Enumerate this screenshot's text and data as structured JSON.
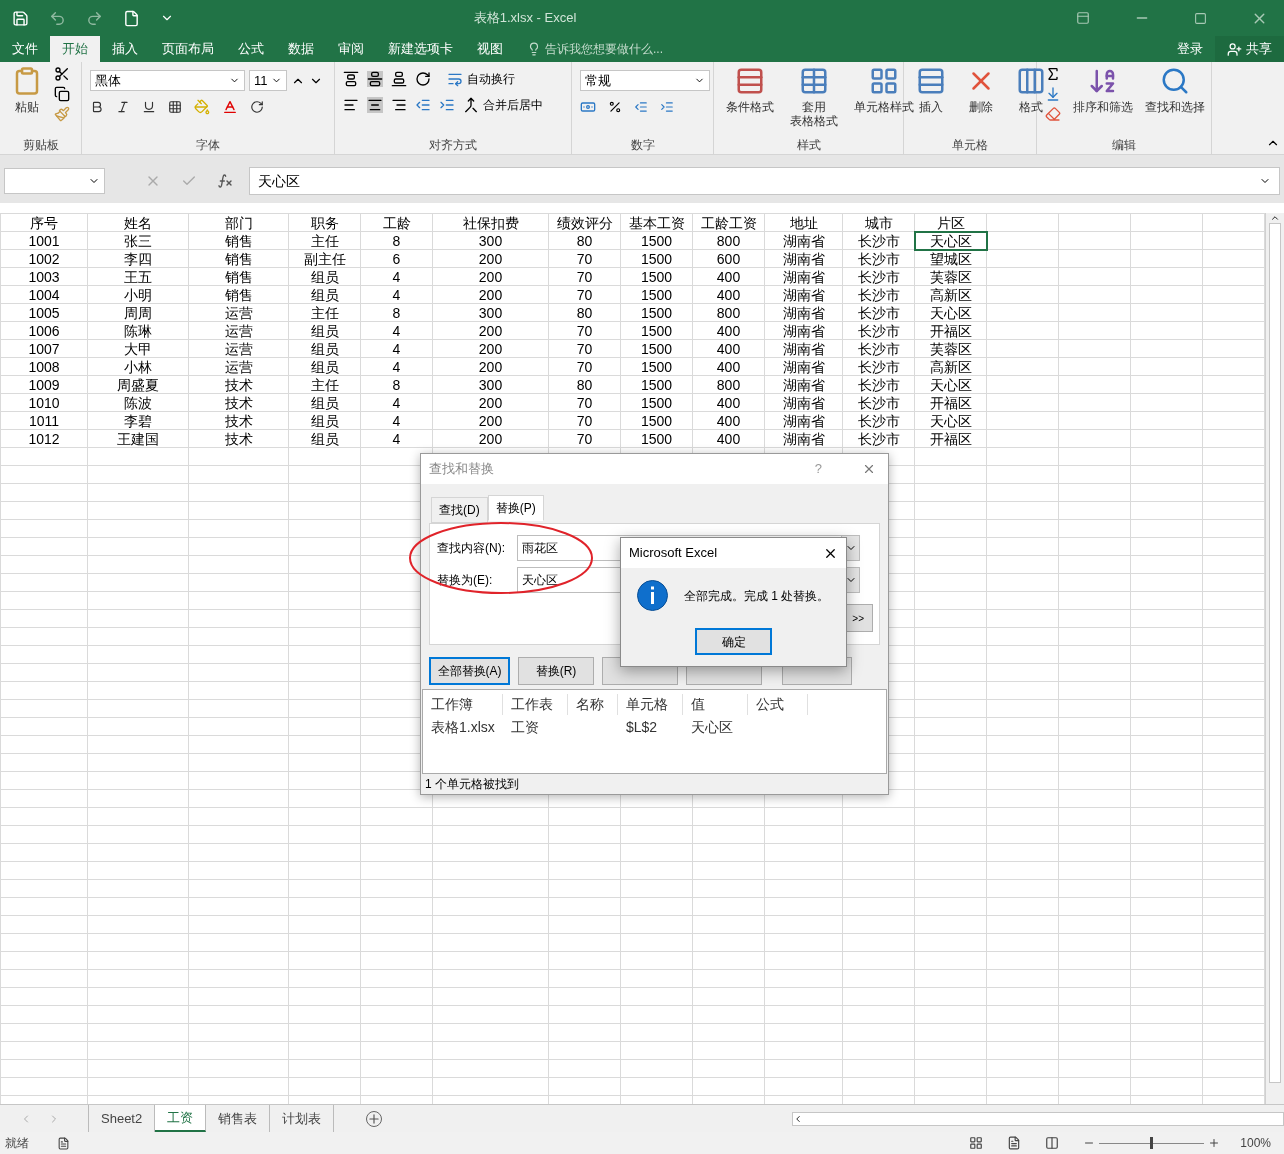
{
  "window": {
    "title": "表格1.xlsx - Excel"
  },
  "ribbon_tabs": [
    {
      "label": "文件",
      "selected": false
    },
    {
      "label": "开始",
      "selected": true
    },
    {
      "label": "插入",
      "selected": false
    },
    {
      "label": "页面布局",
      "selected": false
    },
    {
      "label": "公式",
      "selected": false
    },
    {
      "label": "数据",
      "selected": false
    },
    {
      "label": "审阅",
      "selected": false
    },
    {
      "label": "新建选项卡",
      "selected": false
    },
    {
      "label": "视图",
      "selected": false
    }
  ],
  "tell_me": "告诉我您想要做什么...",
  "account": {
    "sign_in": "登录",
    "share": "共享"
  },
  "ribbon": {
    "clipboard": {
      "label": "剪贴板",
      "paste": "粘贴"
    },
    "font": {
      "label": "字体",
      "font_name": "黑体",
      "font_size": "11"
    },
    "alignment": {
      "label": "对齐方式",
      "wrap": "自动换行",
      "merge": "合并后居中"
    },
    "number": {
      "label": "数字",
      "format": "常规"
    },
    "styles": {
      "label": "样式",
      "buttons": [
        {
          "kind": "conditional",
          "label": "条件格式"
        },
        {
          "kind": "table",
          "label": "套用",
          "label2": "表格格式"
        },
        {
          "kind": "cellstyle",
          "label": "单元格样式"
        }
      ]
    },
    "cells": {
      "label": "单元格",
      "buttons": [
        {
          "kind": "insert",
          "label": "插入"
        },
        {
          "kind": "delete",
          "label": "删除"
        },
        {
          "kind": "format",
          "label": "格式"
        }
      ]
    },
    "editing": {
      "label": "编辑",
      "buttons": [
        {
          "kind": "sort",
          "label": "排序和筛选"
        },
        {
          "kind": "find",
          "label": "查找和选择"
        }
      ]
    }
  },
  "formula_bar": {
    "value": "天心区"
  },
  "sheet": {
    "columns": [
      "序号",
      "姓名",
      "部门",
      "职务",
      "工龄",
      "社保扣费",
      "绩效评分",
      "基本工资",
      "工龄工资",
      "地址",
      "城市",
      "片区"
    ],
    "rows": [
      {
        "cells": [
          {
            "text": "1001",
            "selected": false
          },
          {
            "text": "张三",
            "selected": false
          },
          {
            "text": "销售",
            "selected": false
          },
          {
            "text": "主任",
            "selected": false
          },
          {
            "text": "8",
            "selected": false
          },
          {
            "text": "300",
            "selected": false
          },
          {
            "text": "80",
            "selected": false
          },
          {
            "text": "1500",
            "selected": false
          },
          {
            "text": "800",
            "selected": false
          },
          {
            "text": "湖南省",
            "selected": false
          },
          {
            "text": "长沙市",
            "selected": false
          },
          {
            "text": "天心区",
            "selected": true
          }
        ]
      },
      {
        "cells": [
          {
            "text": "1002",
            "selected": false
          },
          {
            "text": "李四",
            "selected": false
          },
          {
            "text": "销售",
            "selected": false
          },
          {
            "text": "副主任",
            "selected": false
          },
          {
            "text": "6",
            "selected": false
          },
          {
            "text": "200",
            "selected": false
          },
          {
            "text": "70",
            "selected": false
          },
          {
            "text": "1500",
            "selected": false
          },
          {
            "text": "600",
            "selected": false
          },
          {
            "text": "湖南省",
            "selected": false
          },
          {
            "text": "长沙市",
            "selected": false
          },
          {
            "text": "望城区",
            "selected": false
          }
        ]
      },
      {
        "cells": [
          {
            "text": "1003",
            "selected": false
          },
          {
            "text": "王五",
            "selected": false
          },
          {
            "text": "销售",
            "selected": false
          },
          {
            "text": "组员",
            "selected": false
          },
          {
            "text": "4",
            "selected": false
          },
          {
            "text": "200",
            "selected": false
          },
          {
            "text": "70",
            "selected": false
          },
          {
            "text": "1500",
            "selected": false
          },
          {
            "text": "400",
            "selected": false
          },
          {
            "text": "湖南省",
            "selected": false
          },
          {
            "text": "长沙市",
            "selected": false
          },
          {
            "text": "芙蓉区",
            "selected": false
          }
        ]
      },
      {
        "cells": [
          {
            "text": "1004",
            "selected": false
          },
          {
            "text": "小明",
            "selected": false
          },
          {
            "text": "销售",
            "selected": false
          },
          {
            "text": "组员",
            "selected": false
          },
          {
            "text": "4",
            "selected": false
          },
          {
            "text": "200",
            "selected": false
          },
          {
            "text": "70",
            "selected": false
          },
          {
            "text": "1500",
            "selected": false
          },
          {
            "text": "400",
            "selected": false
          },
          {
            "text": "湖南省",
            "selected": false
          },
          {
            "text": "长沙市",
            "selected": false
          },
          {
            "text": "高新区",
            "selected": false
          }
        ]
      },
      {
        "cells": [
          {
            "text": "1005",
            "selected": false
          },
          {
            "text": "周周",
            "selected": false
          },
          {
            "text": "运营",
            "selected": false
          },
          {
            "text": "主任",
            "selected": false
          },
          {
            "text": "8",
            "selected": false
          },
          {
            "text": "300",
            "selected": false
          },
          {
            "text": "80",
            "selected": false
          },
          {
            "text": "1500",
            "selected": false
          },
          {
            "text": "800",
            "selected": false
          },
          {
            "text": "湖南省",
            "selected": false
          },
          {
            "text": "长沙市",
            "selected": false
          },
          {
            "text": "天心区",
            "selected": false
          }
        ]
      },
      {
        "cells": [
          {
            "text": "1006",
            "selected": false
          },
          {
            "text": "陈琳",
            "selected": false
          },
          {
            "text": "运营",
            "selected": false
          },
          {
            "text": "组员",
            "selected": false
          },
          {
            "text": "4",
            "selected": false
          },
          {
            "text": "200",
            "selected": false
          },
          {
            "text": "70",
            "selected": false
          },
          {
            "text": "1500",
            "selected": false
          },
          {
            "text": "400",
            "selected": false
          },
          {
            "text": "湖南省",
            "selected": false
          },
          {
            "text": "长沙市",
            "selected": false
          },
          {
            "text": "开福区",
            "selected": false
          }
        ]
      },
      {
        "cells": [
          {
            "text": "1007",
            "selected": false
          },
          {
            "text": "大甲",
            "selected": false
          },
          {
            "text": "运营",
            "selected": false
          },
          {
            "text": "组员",
            "selected": false
          },
          {
            "text": "4",
            "selected": false
          },
          {
            "text": "200",
            "selected": false
          },
          {
            "text": "70",
            "selected": false
          },
          {
            "text": "1500",
            "selected": false
          },
          {
            "text": "400",
            "selected": false
          },
          {
            "text": "湖南省",
            "selected": false
          },
          {
            "text": "长沙市",
            "selected": false
          },
          {
            "text": "芙蓉区",
            "selected": false
          }
        ]
      },
      {
        "cells": [
          {
            "text": "1008",
            "selected": false
          },
          {
            "text": "小林",
            "selected": false
          },
          {
            "text": "运营",
            "selected": false
          },
          {
            "text": "组员",
            "selected": false
          },
          {
            "text": "4",
            "selected": false
          },
          {
            "text": "200",
            "selected": false
          },
          {
            "text": "70",
            "selected": false
          },
          {
            "text": "1500",
            "selected": false
          },
          {
            "text": "400",
            "selected": false
          },
          {
            "text": "湖南省",
            "selected": false
          },
          {
            "text": "长沙市",
            "selected": false
          },
          {
            "text": "高新区",
            "selected": false
          }
        ]
      },
      {
        "cells": [
          {
            "text": "1009",
            "selected": false
          },
          {
            "text": "周盛夏",
            "selected": false
          },
          {
            "text": "技术",
            "selected": false
          },
          {
            "text": "主任",
            "selected": false
          },
          {
            "text": "8",
            "selected": false
          },
          {
            "text": "300",
            "selected": false
          },
          {
            "text": "80",
            "selected": false
          },
          {
            "text": "1500",
            "selected": false
          },
          {
            "text": "800",
            "selected": false
          },
          {
            "text": "湖南省",
            "selected": false
          },
          {
            "text": "长沙市",
            "selected": false
          },
          {
            "text": "天心区",
            "selected": false
          }
        ]
      },
      {
        "cells": [
          {
            "text": "1010",
            "selected": false
          },
          {
            "text": "陈波",
            "selected": false
          },
          {
            "text": "技术",
            "selected": false
          },
          {
            "text": "组员",
            "selected": false
          },
          {
            "text": "4",
            "selected": false
          },
          {
            "text": "200",
            "selected": false
          },
          {
            "text": "70",
            "selected": false
          },
          {
            "text": "1500",
            "selected": false
          },
          {
            "text": "400",
            "selected": false
          },
          {
            "text": "湖南省",
            "selected": false
          },
          {
            "text": "长沙市",
            "selected": false
          },
          {
            "text": "开福区",
            "selected": false
          }
        ]
      },
      {
        "cells": [
          {
            "text": "1011",
            "selected": false
          },
          {
            "text": "李碧",
            "selected": false
          },
          {
            "text": "技术",
            "selected": false
          },
          {
            "text": "组员",
            "selected": false
          },
          {
            "text": "4",
            "selected": false
          },
          {
            "text": "200",
            "selected": false
          },
          {
            "text": "70",
            "selected": false
          },
          {
            "text": "1500",
            "selected": false
          },
          {
            "text": "400",
            "selected": false
          },
          {
            "text": "湖南省",
            "selected": false
          },
          {
            "text": "长沙市",
            "selected": false
          },
          {
            "text": "天心区",
            "selected": false
          }
        ]
      },
      {
        "cells": [
          {
            "text": "1012",
            "selected": false
          },
          {
            "text": "王建国",
            "selected": false
          },
          {
            "text": "技术",
            "selected": false
          },
          {
            "text": "组员",
            "selected": false
          },
          {
            "text": "4",
            "selected": false
          },
          {
            "text": "200",
            "selected": false
          },
          {
            "text": "70",
            "selected": false
          },
          {
            "text": "1500",
            "selected": false
          },
          {
            "text": "400",
            "selected": false
          },
          {
            "text": "湖南省",
            "selected": false
          },
          {
            "text": "长沙市",
            "selected": false
          },
          {
            "text": "开福区",
            "selected": false
          }
        ]
      }
    ]
  },
  "dialog": {
    "title": "查找和替换",
    "help": "?",
    "tabs": [
      {
        "label": "查找(D)",
        "selected": false
      },
      {
        "label": "替换(P)",
        "selected": true
      }
    ],
    "fields": [
      {
        "label": "查找内容(N):",
        "value": "雨花区"
      },
      {
        "label": "替换为(E):",
        "value": "天心区"
      }
    ],
    "options_button": ">>",
    "buttons": [
      {
        "label": "全部替换(A)",
        "focused": true
      },
      {
        "label": "替换(R)",
        "focused": false
      },
      {
        "focused": false
      },
      {
        "focused": false
      },
      {
        "focused": false
      }
    ],
    "results": {
      "columns": [
        "工作簿",
        "工作表",
        "名称",
        "单元格",
        "值",
        "公式"
      ],
      "rows": [
        {
          "workbook": "表格1.xlsx",
          "sheet": "工资",
          "cell": "$L$2",
          "value": "天心区"
        }
      ]
    },
    "status": "1 个单元格被找到"
  },
  "message_box": {
    "title": "Microsoft Excel",
    "message": "全部完成。完成 1 处替换。",
    "button": "确定"
  },
  "sheet_tabs": [
    {
      "label": "Sheet2",
      "selected": false
    },
    {
      "label": "工资",
      "selected": true
    },
    {
      "label": "销售表",
      "selected": false
    },
    {
      "label": "计划表",
      "selected": false
    }
  ],
  "status_bar": {
    "state": "就绪",
    "zoom": {
      "level": 0.5,
      "label": "100%"
    }
  }
}
